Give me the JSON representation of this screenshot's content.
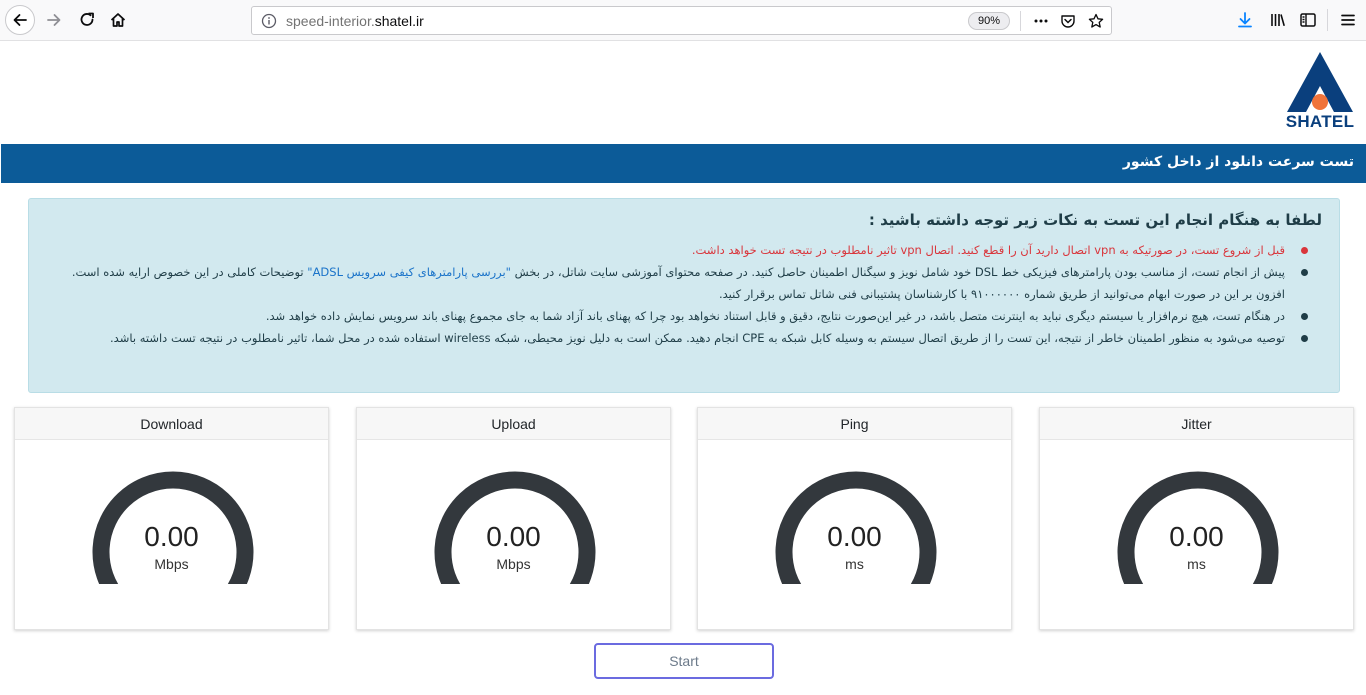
{
  "browser": {
    "url_host_prefix": "speed-interior.",
    "url_host_domain": "shatel.ir",
    "zoom": "90%"
  },
  "logo": {
    "text": "SHATEL",
    "colors": {
      "navy": "#0a3f7d",
      "orange": "#f0733a"
    }
  },
  "title_bar": {
    "text": "تست سرعت دانلود از داخل کشور",
    "color": "#0c5b98"
  },
  "notice": {
    "heading": "لطفا به هنگام انجام این تست به نکات زیر توجه داشته باشید :",
    "items": [
      {
        "text": "قبل از شروع تست، در صورتیکه به vpn اتصال دارید آن را قطع کنید. اتصال vpn تاثیر نامطلوب در نتیجه تست خواهد داشت.",
        "style": "red"
      },
      {
        "text_before_link": "پیش از انجام تست، از مناسب بودن پارامترهای فیزیکی خط DSL خود شامل نویز و سیگنال اطمینان حاصل کنید. در صفحه محتوای آموزشی سایت شاتل، در بخش ",
        "link": "\"بررسی پارامترهای کیفی سرویس ADSL\"",
        "text_after_link": " توضیحات کاملی در این خصوص ارایه شده است. افزون بر این در صورت ابهام می‌توانید از طریق شماره ۹۱۰۰۰۰۰۰ با کارشناسان پشتیبانی فنی شاتل تماس برقرار کنید.",
        "style": "normal"
      },
      {
        "text": "در هنگام تست، هیچ نرم‌افزار یا سیستم دیگری نباید به اینترنت متصل باشد، در غیر این‌صورت نتایج، دقیق و قابل استناد نخواهد بود چرا که پهنای باند آزاد شما به جای مجموع پهنای باند سرویس نمایش داده خواهد شد.",
        "style": "normal"
      },
      {
        "text": "توصیه می‌شود به منظور اطمینان خاطر از نتیجه، این تست را از طریق اتصال سیستم به وسیله کابل شبکه به CPE انجام دهید. ممکن است به دلیل نویز محیطی، شبکه wireless استفاده شده در محل شما، تاثیر نامطلوب در نتیجه تست داشته باشد.",
        "style": "normal"
      }
    ]
  },
  "gauges": [
    {
      "id": "download",
      "title": "Download",
      "value": "0.00",
      "unit": "Mbps"
    },
    {
      "id": "upload",
      "title": "Upload",
      "value": "0.00",
      "unit": "Mbps"
    },
    {
      "id": "ping",
      "title": "Ping",
      "value": "0.00",
      "unit": "ms"
    },
    {
      "id": "jitter",
      "title": "Jitter",
      "value": "0.00",
      "unit": "ms"
    }
  ],
  "gauge_color": "#33383d",
  "start_button": {
    "label": "Start"
  }
}
